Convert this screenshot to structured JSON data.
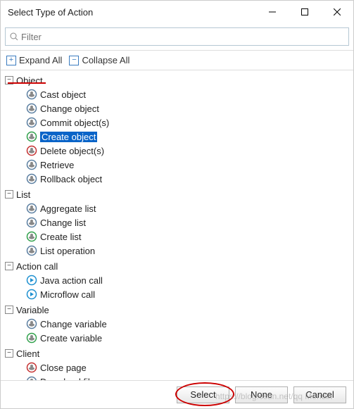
{
  "window": {
    "title": "Select Type of Action"
  },
  "filter": {
    "placeholder": "Filter"
  },
  "toolbar": {
    "expand": "Expand All",
    "collapse": "Collapse All"
  },
  "groups": [
    {
      "name": "Object",
      "items": [
        {
          "label": "Cast object",
          "color": "#5a7ea0"
        },
        {
          "label": "Change object",
          "color": "#5a7ea0"
        },
        {
          "label": "Commit object(s)",
          "color": "#5a7ea0"
        },
        {
          "label": "Create object",
          "color": "#2fa04a",
          "selected": true
        },
        {
          "label": "Delete object(s)",
          "color": "#c43030"
        },
        {
          "label": "Retrieve",
          "color": "#5a7ea0"
        },
        {
          "label": "Rollback object",
          "color": "#5a7ea0"
        }
      ]
    },
    {
      "name": "List",
      "items": [
        {
          "label": "Aggregate list",
          "color": "#5a7ea0"
        },
        {
          "label": "Change list",
          "color": "#5a7ea0"
        },
        {
          "label": "Create list",
          "color": "#2fa04a"
        },
        {
          "label": "List operation",
          "color": "#5a7ea0"
        }
      ]
    },
    {
      "name": "Action call",
      "items": [
        {
          "label": "Java action call",
          "color": "#1e90d0",
          "shape": "play"
        },
        {
          "label": "Microflow call",
          "color": "#1e90d0",
          "shape": "play"
        }
      ]
    },
    {
      "name": "Variable",
      "items": [
        {
          "label": "Change variable",
          "color": "#5a7ea0"
        },
        {
          "label": "Create variable",
          "color": "#2fa04a"
        }
      ]
    },
    {
      "name": "Client",
      "items": [
        {
          "label": "Close page",
          "color": "#c43030"
        },
        {
          "label": "Download file",
          "color": "#5a7ea0"
        }
      ]
    }
  ],
  "footer": {
    "select": "Select",
    "none": "None",
    "cancel": "Cancel"
  },
  "watermark": "https://blog.csdn.net/qq   Mendix"
}
